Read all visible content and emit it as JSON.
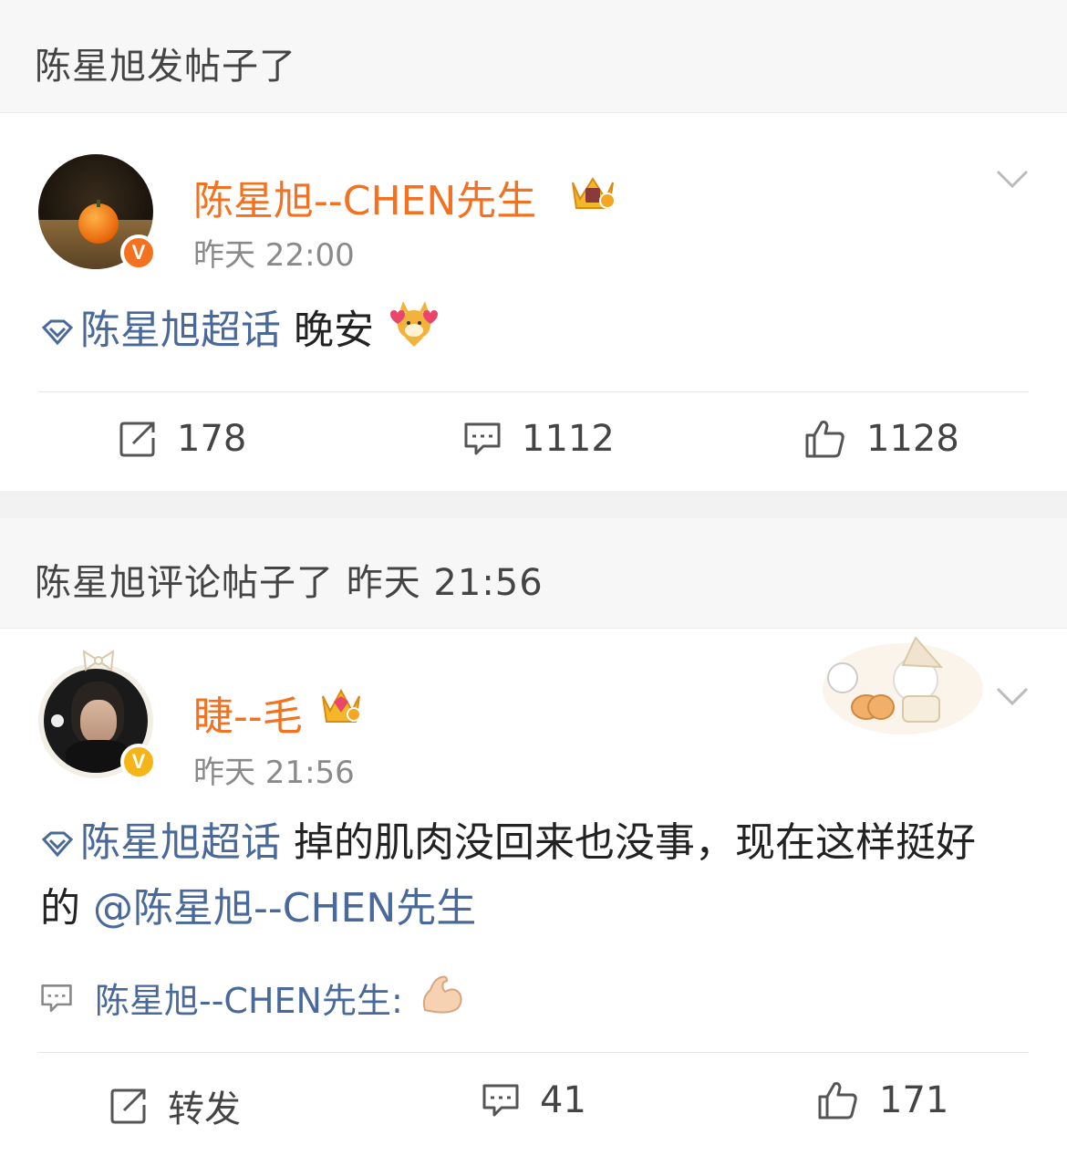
{
  "post1": {
    "header": "陈星旭发帖子了",
    "username": "陈星旭--CHEN先生",
    "time": "昨天 22:00",
    "topic": "陈星旭超话",
    "text": "晚安",
    "reposts": "178",
    "comments": "1112",
    "likes": "1128"
  },
  "post2": {
    "header": "陈星旭评论帖子了 昨天 21:56",
    "username": "睫--毛",
    "time": "昨天 21:56",
    "topic": "陈星旭超话",
    "text": "掉的肌肉没回来也没事，现在这样挺好的",
    "mention": "@陈星旭--CHEN先生",
    "reply_author": "陈星旭--CHEN先生:",
    "repost_label": "转发",
    "comments": "41",
    "likes": "171"
  },
  "colors": {
    "username": "#f4711f",
    "link": "#49699b",
    "badge_orange": "#f4711f",
    "badge_yellow": "#f5b418"
  }
}
